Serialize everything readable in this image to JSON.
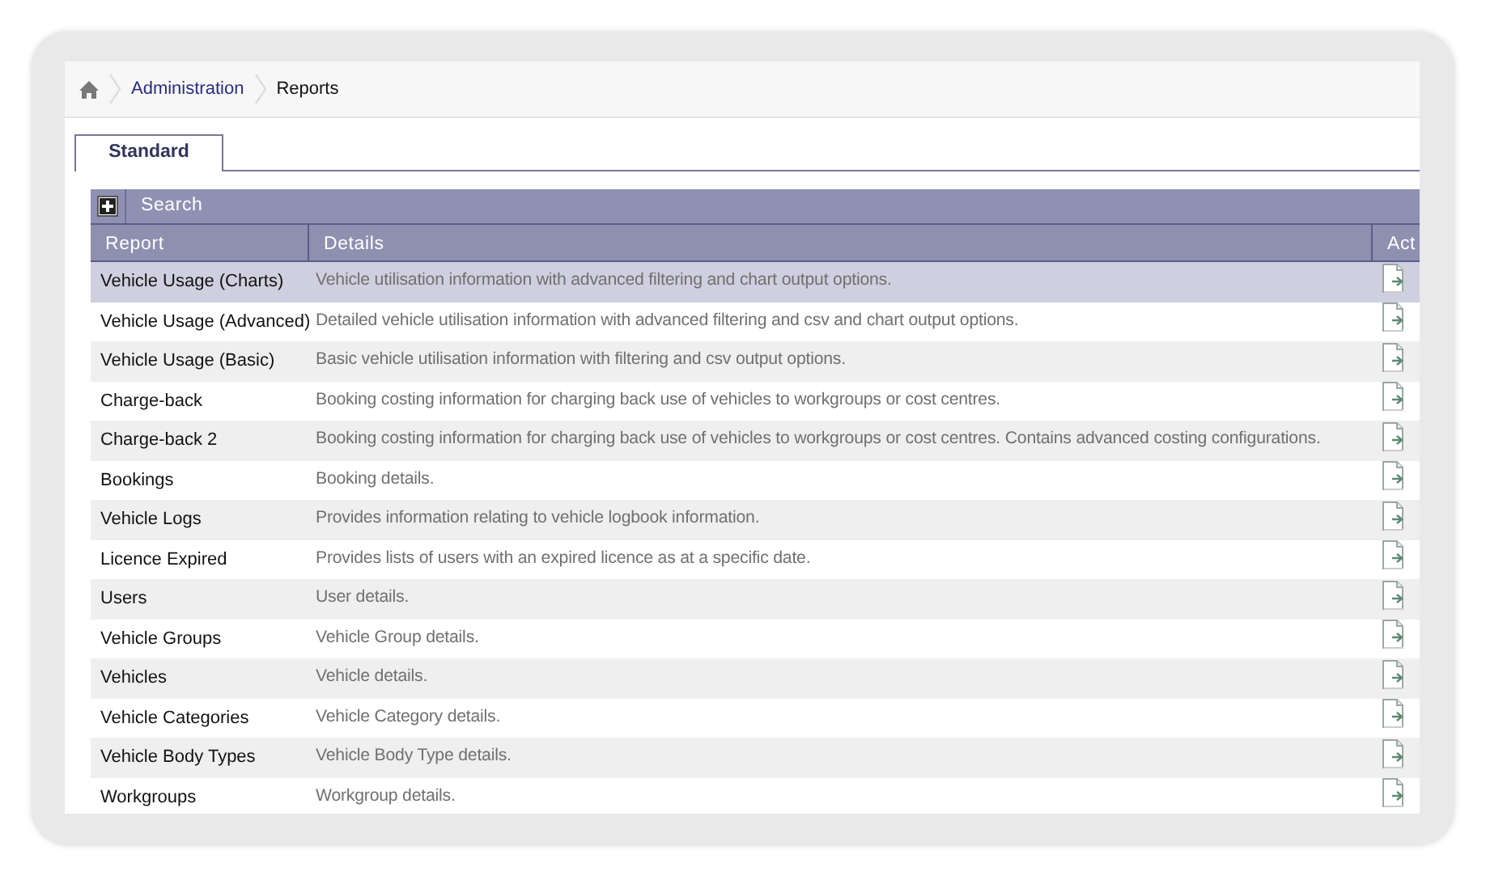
{
  "breadcrumb": [
    {
      "label": "Administration",
      "kind": "link"
    },
    {
      "label": "Reports",
      "kind": "current"
    }
  ],
  "tabs": [
    {
      "label": "Standard",
      "selected": true
    }
  ],
  "search": {
    "label": "Search",
    "expanded": false
  },
  "table": {
    "columns": [
      "Report",
      "Details",
      "Act"
    ],
    "rows": [
      {
        "report": "Vehicle Usage (Charts)",
        "details": "Vehicle utilisation information with advanced filtering and chart output options.",
        "selected": true
      },
      {
        "report": "Vehicle Usage (Advanced)",
        "details": "Detailed vehicle utilisation information with advanced filtering and csv and chart output options.",
        "selected": false
      },
      {
        "report": "Vehicle Usage (Basic)",
        "details": "Basic vehicle utilisation information with filtering and csv output options.",
        "selected": false
      },
      {
        "report": "Charge-back",
        "details": "Booking costing information for charging back use of vehicles to workgroups or cost centres.",
        "selected": false
      },
      {
        "report": "Charge-back 2",
        "details": "Booking costing information for charging back use of vehicles to workgroups or cost centres. Contains advanced costing configurations.",
        "selected": false
      },
      {
        "report": "Bookings",
        "details": "Booking details.",
        "selected": false
      },
      {
        "report": "Vehicle Logs",
        "details": "Provides information relating to vehicle logbook information.",
        "selected": false
      },
      {
        "report": "Licence Expired",
        "details": "Provides lists of users with an expired licence as at a specific date.",
        "selected": false
      },
      {
        "report": "Users",
        "details": "User details.",
        "selected": false
      },
      {
        "report": "Vehicle Groups",
        "details": "Vehicle Group details.",
        "selected": false
      },
      {
        "report": "Vehicles",
        "details": "Vehicle details.",
        "selected": false
      },
      {
        "report": "Vehicle Categories",
        "details": "Vehicle Category details.",
        "selected": false
      },
      {
        "report": "Vehicle Body Types",
        "details": "Vehicle Body Type details.",
        "selected": false
      },
      {
        "report": "Workgroups",
        "details": "Workgroup details.",
        "selected": false
      }
    ]
  }
}
